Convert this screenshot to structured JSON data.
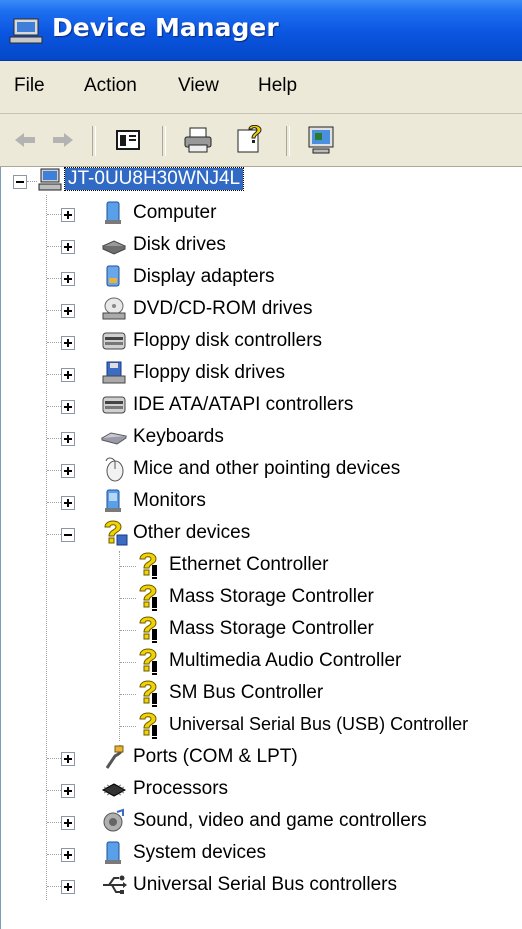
{
  "window": {
    "title": "Device Manager",
    "icon": "device-manager-icon"
  },
  "menu": {
    "file": "File",
    "action": "Action",
    "view": "View",
    "help": "Help"
  },
  "toolbar": [
    {
      "name": "back-icon"
    },
    {
      "name": "forward-icon"
    },
    {
      "name": "show-hide-console-tree-icon"
    },
    {
      "name": "print-icon"
    },
    {
      "name": "properties-help-icon"
    },
    {
      "name": "scan-hardware-icon"
    }
  ],
  "tree": {
    "root": "JT-0UU8H30WNJ4L",
    "categories": [
      {
        "label": "Computer",
        "icon": "computer-icon",
        "expanded": false
      },
      {
        "label": "Disk drives",
        "icon": "disk-drive-icon",
        "expanded": false
      },
      {
        "label": "Display adapters",
        "icon": "display-adapter-icon",
        "expanded": false
      },
      {
        "label": "DVD/CD-ROM drives",
        "icon": "dvd-drive-icon",
        "expanded": false
      },
      {
        "label": "Floppy disk controllers",
        "icon": "floppy-controller-icon",
        "expanded": false
      },
      {
        "label": "Floppy disk drives",
        "icon": "floppy-drive-icon",
        "expanded": false
      },
      {
        "label": "IDE ATA/ATAPI controllers",
        "icon": "ide-controller-icon",
        "expanded": false
      },
      {
        "label": "Keyboards",
        "icon": "keyboard-icon",
        "expanded": false
      },
      {
        "label": "Mice and other pointing devices",
        "icon": "mouse-icon",
        "expanded": false
      },
      {
        "label": "Monitors",
        "icon": "monitor-icon",
        "expanded": false
      },
      {
        "label": "Other devices",
        "icon": "unknown-device-icon",
        "expanded": true
      }
    ],
    "other_devices": [
      "Ethernet Controller",
      "Mass Storage Controller",
      "Mass Storage Controller",
      "Multimedia Audio Controller",
      "SM Bus Controller",
      "Universal Serial Bus (USB) Controller"
    ],
    "categories_after": [
      {
        "label": "Ports (COM & LPT)",
        "icon": "port-icon",
        "expanded": false
      },
      {
        "label": "Processors",
        "icon": "processor-icon",
        "expanded": false
      },
      {
        "label": "Sound, video and game controllers",
        "icon": "sound-icon",
        "expanded": false
      },
      {
        "label": "System devices",
        "icon": "system-device-icon",
        "expanded": false
      },
      {
        "label": "Universal Serial Bus controllers",
        "icon": "usb-icon",
        "expanded": false
      }
    ]
  },
  "colors": {
    "titlebar": "#0a55e0",
    "selection": "#316ac5",
    "chrome": "#ece9d8",
    "warning": "#f2d200"
  }
}
